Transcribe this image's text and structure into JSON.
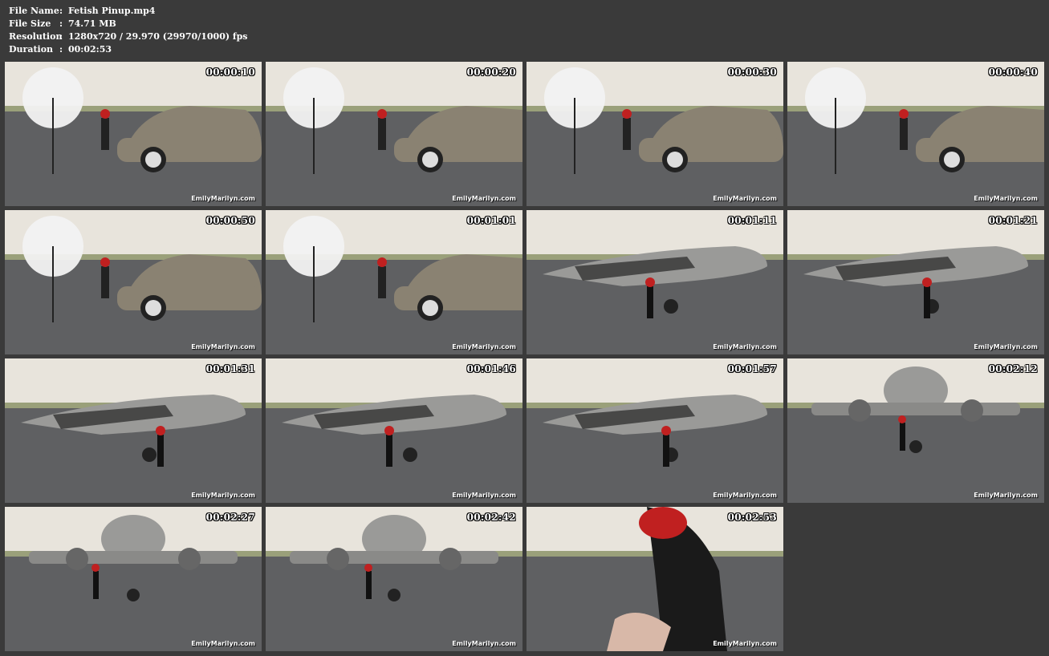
{
  "info": [
    {
      "key": "File Name",
      "value": "Fetish Pinup.mp4"
    },
    {
      "key": "File Size",
      "value": "74.71 MB"
    },
    {
      "key": "Resolution",
      "value": "1280x720 / 29.970 (29970/1000) fps"
    },
    {
      "key": "Duration",
      "value": "00:02:53"
    }
  ],
  "separator": ":",
  "watermark": "EmilyMarilyn.com",
  "thumbnails": [
    {
      "time": "00:00:10",
      "scene": "car"
    },
    {
      "time": "00:00:20",
      "scene": "car"
    },
    {
      "time": "00:00:30",
      "scene": "car"
    },
    {
      "time": "00:00:40",
      "scene": "car"
    },
    {
      "time": "00:00:50",
      "scene": "car"
    },
    {
      "time": "00:01:01",
      "scene": "car"
    },
    {
      "time": "00:01:11",
      "scene": "plane-close"
    },
    {
      "time": "00:01:21",
      "scene": "plane"
    },
    {
      "time": "00:01:31",
      "scene": "plane"
    },
    {
      "time": "00:01:46",
      "scene": "plane"
    },
    {
      "time": "00:01:57",
      "scene": "plane"
    },
    {
      "time": "00:02:12",
      "scene": "plane-front"
    },
    {
      "time": "00:02:27",
      "scene": "plane-front"
    },
    {
      "time": "00:02:42",
      "scene": "plane-front"
    },
    {
      "time": "00:02:53",
      "scene": "closeup"
    }
  ],
  "colors": {
    "background": "#3a3a3a",
    "sky": "#e8e4dc",
    "tarmac": "#5f6062",
    "car": "#8a8272",
    "plane": "#9a9a98",
    "hair": "#c02020"
  }
}
